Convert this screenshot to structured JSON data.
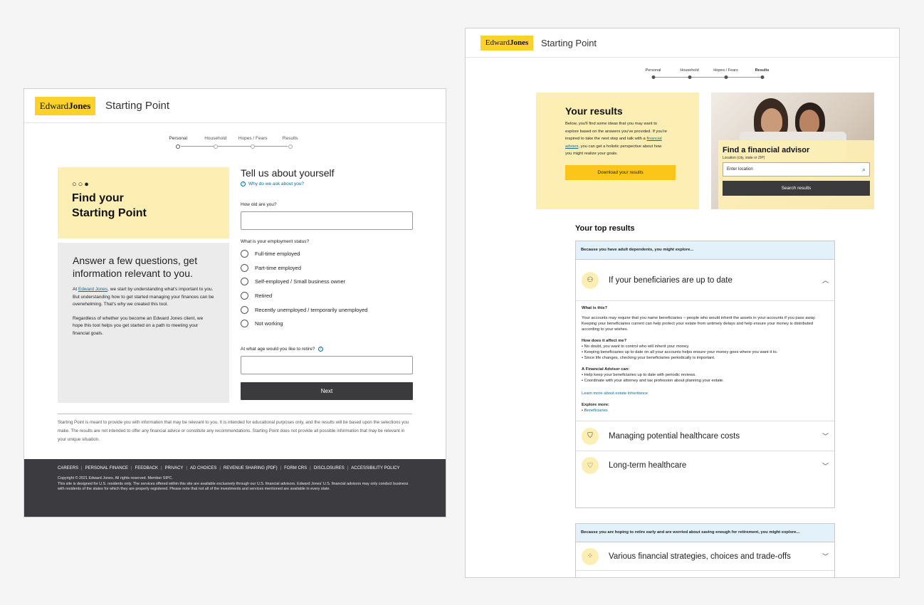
{
  "left": {
    "brand": {
      "part1": "Edward",
      "part2": "Jones"
    },
    "app_title": "Starting Point",
    "steps": [
      "Personal",
      "Household",
      "Hopes / Fears",
      "Results"
    ],
    "hero": {
      "dots": "○○●",
      "line1": "Find your",
      "line2": "Starting Point"
    },
    "intro": {
      "heading": "Answer a few questions, get information relevant to you.",
      "p1_pre": "At ",
      "p1_link": "Edward Jones",
      "p1_post": ", we start by understanding what's important to you. But understanding how to get started managing your finances can be overwhelming. That's why we created this tool.",
      "p2": "Regardless of whether you become an Edward Jones client, we hope this tool helps you get started on a path to meeting your financial goals."
    },
    "form": {
      "title": "Tell us about yourself",
      "why": "Why do we ask about you?",
      "q_age": "How old are you?",
      "q_employment": "What is your employment status?",
      "options": [
        "Full-time employed",
        "Part-time employed",
        "Self-employed / Small business owner",
        "Retired",
        "Recently unemployed / temporarily unemployed",
        "Not working"
      ],
      "q_retire": "At what age would you like to retire?",
      "next": "Next"
    },
    "disclaimer": "Starting Point is meant to provide you with information that may be relevant to you. It is intended for educational purposes only, and the results will be based upon the selections you make. The results are not intended to offer any financial advice or constitute any recommendations. Starting Point does not provide all possible information that may be relevant in your unique situation.",
    "footer": {
      "links": [
        "CAREERS",
        "PERSONAL FINANCE",
        "FEEDBACK",
        "PRIVACY",
        "AD CHOICES",
        "REVENUE SHARING (PDF)",
        "FORM CRS",
        "DISCLOSURES",
        "ACCESSIBILITY POLICY"
      ],
      "copy1": "Copyright © 2021 Edward Jones. All rights reserved. Member SIPC.",
      "copy2": "This site is designed for U.S. residents only. The services offered within this site are available exclusively through our U.S. financial advisors. Edward Jones' U.S. financial advisors may only conduct business with residents of the states for which they are properly registered. Please note that not all of the investments and services mentioned are available in every state."
    }
  },
  "right": {
    "brand": {
      "part1": "Edward",
      "part2": "Jones"
    },
    "app_title": "Starting Point",
    "steps": [
      "Personal",
      "Household",
      "Hopes / Fears",
      "Results"
    ],
    "results": {
      "title": "Your results",
      "text_pre": "Below, you'll find some ideas that you may want to explore based on the answers you've provided. If you're inspired to take the next step and talk with a ",
      "text_link": "financial advisor",
      "text_post": ", you can get a holistic perspective about how you might realize your goals.",
      "download": "Download your results"
    },
    "advisor": {
      "title": "Find a financial advisor",
      "sub": "Location (city, state or ZIP)",
      "placeholder": "Enter location",
      "search": "Search results"
    },
    "top_results": "Your top results",
    "group1": {
      "head": "Because you have adult dependents, you might explore...",
      "item1": "If your beneficiaries are up to date",
      "what_h": "What is this?",
      "what_p": "Your accounts may require that you name beneficiaries – people who would inherit the assets in your accounts if you pass away. Keeping your beneficiaries current can help protect your estate from untimely delays and help ensure your money is distributed according to your wishes.",
      "affect_h": "How does it affect me?",
      "affect": [
        "No doubt, you want to control who will inherit your money.",
        "Keeping beneficiaries up to date on all your accounts helps ensure your money goes where you want it to.",
        "Since life changes, checking your beneficiaries periodically is important."
      ],
      "fa_h": "A Financial Advisor can:",
      "fa": [
        "Help keep your beneficiaries up to date with periodic reviews.",
        "Coordinate with your attorney and tax profession about planning your estate."
      ],
      "learn": "Learn more about estate inheritance",
      "explore_h": "Explore more:",
      "explore": "Beneficiaries",
      "item2": "Managing potential healthcare costs",
      "item3": "Long-term healthcare"
    },
    "group2": {
      "head": "Because you are hoping to retire early and are worried about saving enough for retirement, you might explore...",
      "item1": "Various financial strategies, choices and trade-offs"
    }
  }
}
